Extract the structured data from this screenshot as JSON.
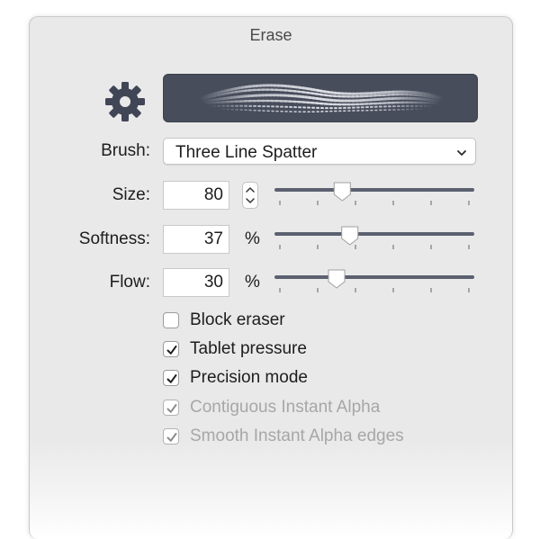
{
  "panel": {
    "title": "Erase"
  },
  "icons": {
    "settings": "gear-icon",
    "dropdown": "chevron-down-icon",
    "stepper": "stepper-icon",
    "check": "checkmark-icon"
  },
  "brush": {
    "label": "Brush:",
    "value": "Three Line Spatter"
  },
  "size": {
    "label": "Size:",
    "value": "80",
    "slider_fraction": 0.33
  },
  "softness": {
    "label": "Softness:",
    "value": "37",
    "unit": "%",
    "slider_fraction": 0.37
  },
  "flow": {
    "label": "Flow:",
    "value": "30",
    "unit": "%",
    "slider_fraction": 0.3
  },
  "options": [
    {
      "label": "Block eraser",
      "checked": false,
      "enabled": true
    },
    {
      "label": "Tablet pressure",
      "checked": true,
      "enabled": true
    },
    {
      "label": "Precision mode",
      "checked": true,
      "enabled": true
    },
    {
      "label": "Contiguous Instant Alpha",
      "checked": true,
      "enabled": false
    },
    {
      "label": "Smooth Instant Alpha edges",
      "checked": true,
      "enabled": false
    }
  ],
  "colors": {
    "preview_bg": "#484d5c",
    "slider_track": "#5c6170",
    "disabled_text": "#a7a7a7"
  }
}
